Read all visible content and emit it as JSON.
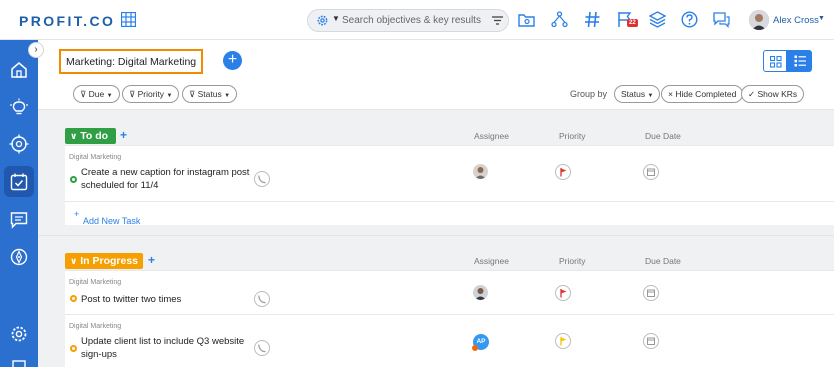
{
  "app": {
    "logo": "PROFIT.CO"
  },
  "search": {
    "placeholder": "Search objectives & key results"
  },
  "user": {
    "name": "Alex Cross"
  },
  "notifications": {
    "count": "22"
  },
  "page": {
    "title": "Marketing: Digital Marketing"
  },
  "filters": {
    "due": "Due",
    "priority": "Priority",
    "status": "Status"
  },
  "group_by": {
    "label": "Group by",
    "value": "Status",
    "hide_completed": "Hide Completed",
    "show_krs": "Show KRs"
  },
  "columns": {
    "assignee": "Assignee",
    "priority": "Priority",
    "due_date": "Due Date"
  },
  "sections": [
    {
      "name": "To do",
      "color": "#2f9e44",
      "add_task_label": "Add New Task",
      "tasks": [
        {
          "category": "Digital Marketing",
          "title": "Create a new caption for instagram post scheduled for 11/4",
          "status_color": "#2f9e44",
          "priority_color": "#e03131"
        }
      ]
    },
    {
      "name": "In Progress",
      "color": "#f59f00",
      "tasks": [
        {
          "category": "Digital Marketing",
          "title": "Post to twitter two times",
          "status_color": "#f59f00",
          "priority_color": "#e03131"
        },
        {
          "category": "Digital Marketing",
          "title": "Update client list to include Q3 website sign-ups",
          "status_color": "#f59f00",
          "priority_color": "#f5c400",
          "assignee_initials": "AP"
        }
      ]
    }
  ],
  "colors": {
    "brand": "#1d5fa8",
    "sidebar": "#2b6fcf",
    "accent": "#2b80e8",
    "highlight_border": "#f08c00"
  },
  "icons": [
    "apps-grid-icon",
    "gear-icon",
    "filter-icon",
    "folder-icon",
    "network-icon",
    "hashtag-icon",
    "flag-notification-icon",
    "layers-icon",
    "help-icon",
    "chat-icon",
    "home-icon",
    "lightbulb-icon",
    "target-icon",
    "calendar-check-icon",
    "message-icon",
    "compass-icon",
    "settings-icon",
    "phone-icon",
    "flag-icon",
    "calendar-icon"
  ]
}
